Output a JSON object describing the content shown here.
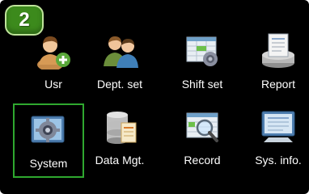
{
  "step_badge": "2",
  "menu": {
    "items": [
      {
        "label": "Usr",
        "icon": "add-user-icon"
      },
      {
        "label": "Dept. set",
        "icon": "department-icon"
      },
      {
        "label": "Shift set",
        "icon": "shift-schedule-icon"
      },
      {
        "label": "Report",
        "icon": "report-icon"
      },
      {
        "label": "System",
        "icon": "system-settings-icon"
      },
      {
        "label": "Data Mgt.",
        "icon": "database-icon"
      },
      {
        "label": "Record",
        "icon": "record-search-icon"
      },
      {
        "label": "Sys. info.",
        "icon": "system-info-icon"
      }
    ],
    "selected": "System",
    "colors": {
      "background": "#000000",
      "selection": "#2fa82f",
      "badge": "#3c8a1c",
      "text": "#ffffff"
    }
  }
}
